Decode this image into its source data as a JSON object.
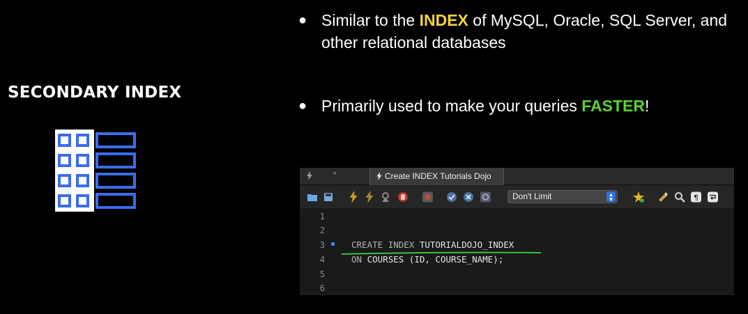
{
  "left_panel": {
    "heading": "SECONDARY INDEX"
  },
  "bullets": [
    {
      "dot": "●",
      "before": "Similar to the ",
      "highlight": "INDEX",
      "after": " of MySQL, Oracle, SQL Server, and other relational databases"
    },
    {
      "dot": "●",
      "before": "Primarily used to make your queries ",
      "highlight": "FASTER",
      "after": "!"
    }
  ],
  "editor": {
    "ghost_tab_marker": "*",
    "active_tab_label": "Create INDEX Tutorials Dojo",
    "limit_select": "Don't Limit",
    "line_numbers": [
      "1",
      "2",
      "3",
      "4",
      "5",
      "6"
    ],
    "line3": {
      "kw1": "CREATE",
      "kw2": "INDEX",
      "name": "TUTORIALDOJO_INDEX"
    },
    "line4": {
      "kw": "ON",
      "rest": "COURSES (ID, COURSE_NAME);"
    }
  },
  "colors": {
    "accent_yellow": "#f3d43b",
    "accent_green": "#5bd235",
    "icon_blue": "#3b6cf0",
    "underline_green": "#3fbf3f"
  },
  "icons": [
    "table-index-icon",
    "folder-icon",
    "save-icon",
    "execute-icon",
    "execute-current-icon",
    "explain-icon",
    "stop-icon",
    "toggle-icon",
    "commit-icon",
    "rollback-icon",
    "autocommit-icon",
    "favorite-icon",
    "beautify-icon",
    "find-icon",
    "invisibles-icon",
    "wrap-icon"
  ]
}
